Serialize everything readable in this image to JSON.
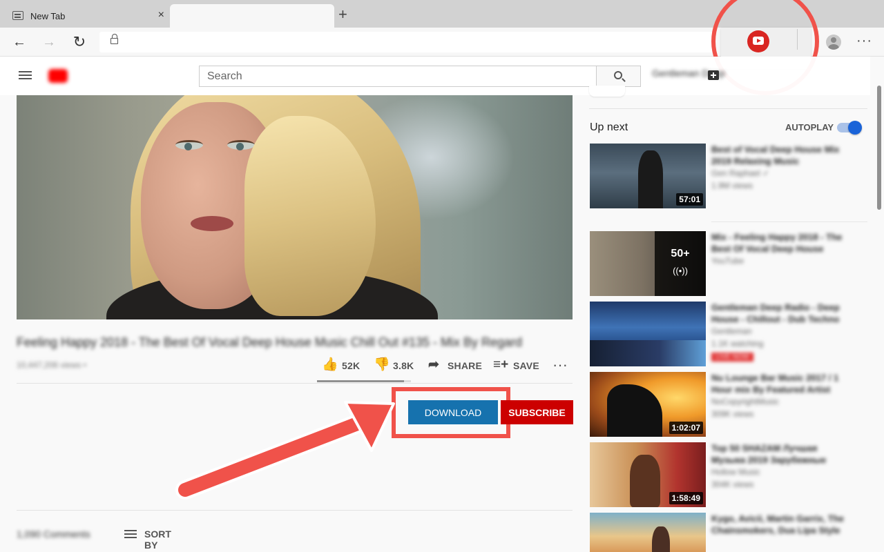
{
  "browser": {
    "tabs": [
      {
        "title": "New Tab",
        "close": "×"
      },
      {
        "title": ""
      }
    ],
    "new_tab_glyph": "+",
    "back_glyph": "←",
    "forward_glyph": "→",
    "reload_glyph": "↻",
    "more_glyph": "···",
    "url": "",
    "extension": {
      "icon": "youtube-downloader-icon",
      "color": "#d92622"
    }
  },
  "youtube": {
    "search_placeholder": "Search",
    "header_blurred_text": "Gentleman Deep",
    "video": {
      "title": "Feeling Happy 2018 - The Best Of Vocal Deep House Music Chill Out #135 - Mix By Regard",
      "views": "10,447,206 views •",
      "likes": "52K",
      "dislikes": "3.8K",
      "like_ratio": 0.93,
      "share_label": "SHARE",
      "save_label": "SAVE",
      "more_glyph": "···"
    },
    "download_label": "DOWNLOAD",
    "subscribe_label": "SUBSCRIBE",
    "comments": {
      "count": "1,090 Comments",
      "sort_label": "SORT BY"
    },
    "sidebar": {
      "up_next": "Up next",
      "autoplay_label": "AUTOPLAY",
      "autoplay_on": true,
      "items": [
        {
          "title": "Best of Vocal Deep House Mix 2019 Relaxing Music",
          "channel": "Gen Raphael ✓",
          "meta": "1.9M views",
          "duration": "57:01"
        },
        {
          "title": "Mix - Feeling Happy 2018 - The Best Of Vocal Deep House",
          "channel": "YouTube",
          "meta": "",
          "mix_count": "50+",
          "mix_icon": "((•))"
        },
        {
          "title": "Gentleman Deep Radio - Deep House - Chillout - Dub Techno",
          "channel": "Gentleman",
          "meta": "1.1K watching",
          "live": "LIVE NOW"
        },
        {
          "title": "Nu Lounge Bar Music 2017 / 1 Hour mix By Featured Artist",
          "channel": "NoCopyrightMusic",
          "meta": "309K views",
          "duration": "1:02:07"
        },
        {
          "title": "Top 50 SHAZAM Лучшая Музыка 2019 Зарубежные",
          "channel": "Hollow Music",
          "meta": "304K views",
          "duration": "1:58:49"
        },
        {
          "title": "Kygo, Avicii, Martin Garrix, The Chainsmokers, Dua Lipa Style",
          "channel": "",
          "meta": ""
        }
      ]
    }
  }
}
